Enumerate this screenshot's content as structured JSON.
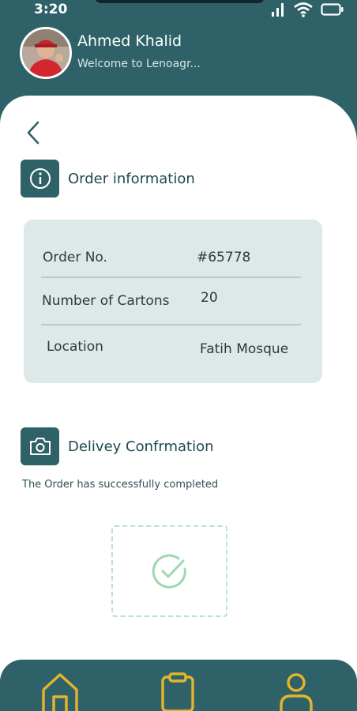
{
  "status_bar": {
    "time": "3:20"
  },
  "user": {
    "name": "Ahmed Khalid",
    "welcome": "Welcome to Lenoagr..."
  },
  "order_section": {
    "title": "Order information",
    "rows": [
      {
        "label": "Order No.",
        "value": "#65778"
      },
      {
        "label": "Number of Cartons",
        "value": "20"
      },
      {
        "label": "Location",
        "value": "Fatih Mosque"
      }
    ]
  },
  "delivery_section": {
    "title": "Delivey Confrmation",
    "message": "The Order has successfully completed"
  },
  "nav": {
    "items": [
      {
        "icon": "home-icon"
      },
      {
        "icon": "clipboard-icon"
      },
      {
        "icon": "profile-icon"
      }
    ]
  },
  "colors": {
    "primary": "#2f6268",
    "accent": "#e4b52c",
    "success": "#9ad9ae",
    "panel": "#dde8e9"
  }
}
